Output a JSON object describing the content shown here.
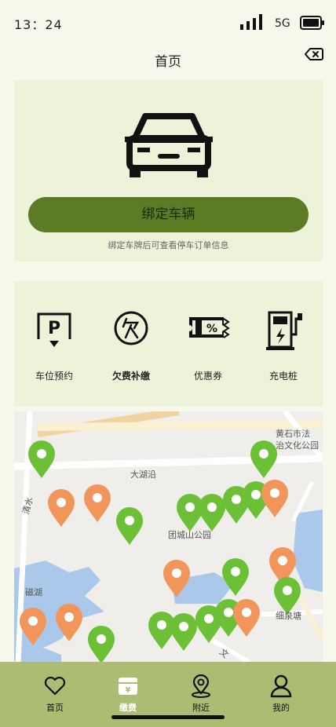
{
  "status": {
    "time": "13：24",
    "network": "5G"
  },
  "header": {
    "title": "首页"
  },
  "bind_card": {
    "button_label": "绑定车辆",
    "hint": "绑定车牌后可查看停车订单信息"
  },
  "services": [
    {
      "label": "车位预约",
      "icon": "parking-icon"
    },
    {
      "label": "欠费补缴",
      "icon": "arrears-icon"
    },
    {
      "label": "优惠券",
      "icon": "coupon-icon"
    },
    {
      "label": "充电桩",
      "icon": "charging-pile-icon"
    }
  ],
  "map": {
    "labels": [
      "黄石市法",
      "治文化公园",
      "大湖沿",
      "团城山公园",
      "磁湖",
      "细泉塘",
      "清水",
      "文"
    ],
    "colors": {
      "green_marker": "#6cc035",
      "orange_marker": "#f2955a"
    }
  },
  "tabs": [
    {
      "label": "首页",
      "icon": "heart-icon",
      "active": false
    },
    {
      "label": "缴费",
      "icon": "wallet-icon",
      "active": true
    },
    {
      "label": "附近",
      "icon": "location-icon",
      "active": false
    },
    {
      "label": "我的",
      "icon": "profile-icon",
      "active": false
    }
  ],
  "colors": {
    "accent": "#5b7b25",
    "tabbar": "#acbd73",
    "card": "#edf3d9",
    "background": "#f7f8ec"
  }
}
